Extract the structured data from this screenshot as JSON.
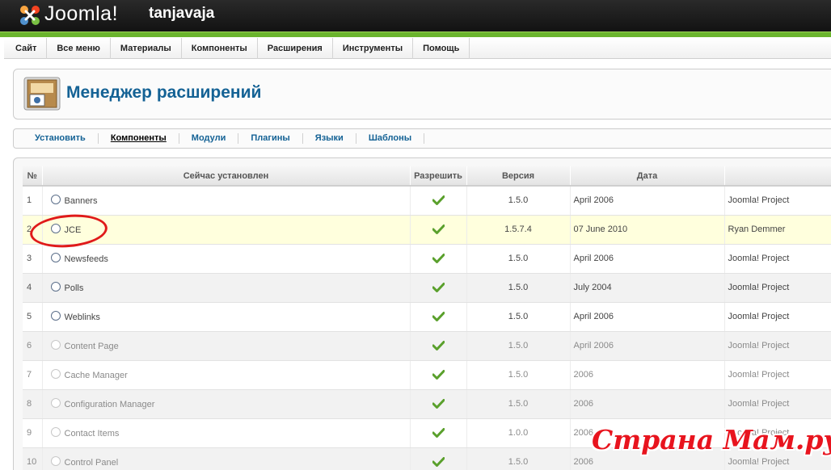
{
  "header": {
    "logo_text": "Joomla!",
    "site_name": "tanjavaja",
    "accent": "#6ab42d"
  },
  "menu": [
    {
      "label": "Сайт",
      "name": "menu-site"
    },
    {
      "label": "Все меню",
      "name": "menu-all-menus"
    },
    {
      "label": "Материалы",
      "name": "menu-content"
    },
    {
      "label": "Компоненты",
      "name": "menu-components"
    },
    {
      "label": "Расширения",
      "name": "menu-extensions"
    },
    {
      "label": "Инструменты",
      "name": "menu-tools"
    },
    {
      "label": "Помощь",
      "name": "menu-help"
    }
  ],
  "page": {
    "title": "Менеджер расширений",
    "title_color": "#146295",
    "icon": "extension-manager-icon"
  },
  "tabs": [
    {
      "label": "Установить",
      "active": false
    },
    {
      "label": "Компоненты",
      "active": true
    },
    {
      "label": "Модули",
      "active": false
    },
    {
      "label": "Плагины",
      "active": false
    },
    {
      "label": "Языки",
      "active": false
    },
    {
      "label": "Шаблоны",
      "active": false
    }
  ],
  "table": {
    "headers": [
      "№",
      "Сейчас установлен",
      "Разрешить",
      "Версия",
      "Дата",
      ""
    ],
    "rows": [
      {
        "num": "1",
        "name": "Banners",
        "enabled": true,
        "version": "1.5.0",
        "date": "April 2006",
        "author": "Joomla! Project",
        "core": false,
        "highlight": false
      },
      {
        "num": "2",
        "name": "JCE",
        "enabled": true,
        "version": "1.5.7.4",
        "date": "07 June 2010",
        "author": "Ryan Demmer",
        "core": false,
        "highlight": true
      },
      {
        "num": "3",
        "name": "Newsfeeds",
        "enabled": true,
        "version": "1.5.0",
        "date": "April 2006",
        "author": "Joomla! Project",
        "core": false,
        "highlight": false
      },
      {
        "num": "4",
        "name": "Polls",
        "enabled": true,
        "version": "1.5.0",
        "date": "July 2004",
        "author": "Joomla! Project",
        "core": false,
        "highlight": false
      },
      {
        "num": "5",
        "name": "Weblinks",
        "enabled": true,
        "version": "1.5.0",
        "date": "April 2006",
        "author": "Joomla! Project",
        "core": false,
        "highlight": false
      },
      {
        "num": "6",
        "name": "Content Page",
        "enabled": true,
        "version": "1.5.0",
        "date": "April 2006",
        "author": "Joomla! Project",
        "core": true,
        "highlight": false
      },
      {
        "num": "7",
        "name": "Cache Manager",
        "enabled": true,
        "version": "1.5.0",
        "date": "2006",
        "author": "Joomla! Project",
        "core": true,
        "highlight": false
      },
      {
        "num": "8",
        "name": "Configuration Manager",
        "enabled": true,
        "version": "1.5.0",
        "date": "2006",
        "author": "Joomla! Project",
        "core": true,
        "highlight": false
      },
      {
        "num": "9",
        "name": "Contact Items",
        "enabled": true,
        "version": "1.0.0",
        "date": "2006",
        "author": "Joomla! Project",
        "core": true,
        "highlight": false
      },
      {
        "num": "10",
        "name": "Control Panel",
        "enabled": true,
        "version": "1.5.0",
        "date": "2006",
        "author": "Joomla! Project",
        "core": true,
        "highlight": false
      }
    ]
  },
  "annotation": {
    "color": "#e01a1a",
    "target_row": "2"
  },
  "watermark": {
    "text": "Страна Мам.ру",
    "color": "#e8141e"
  }
}
